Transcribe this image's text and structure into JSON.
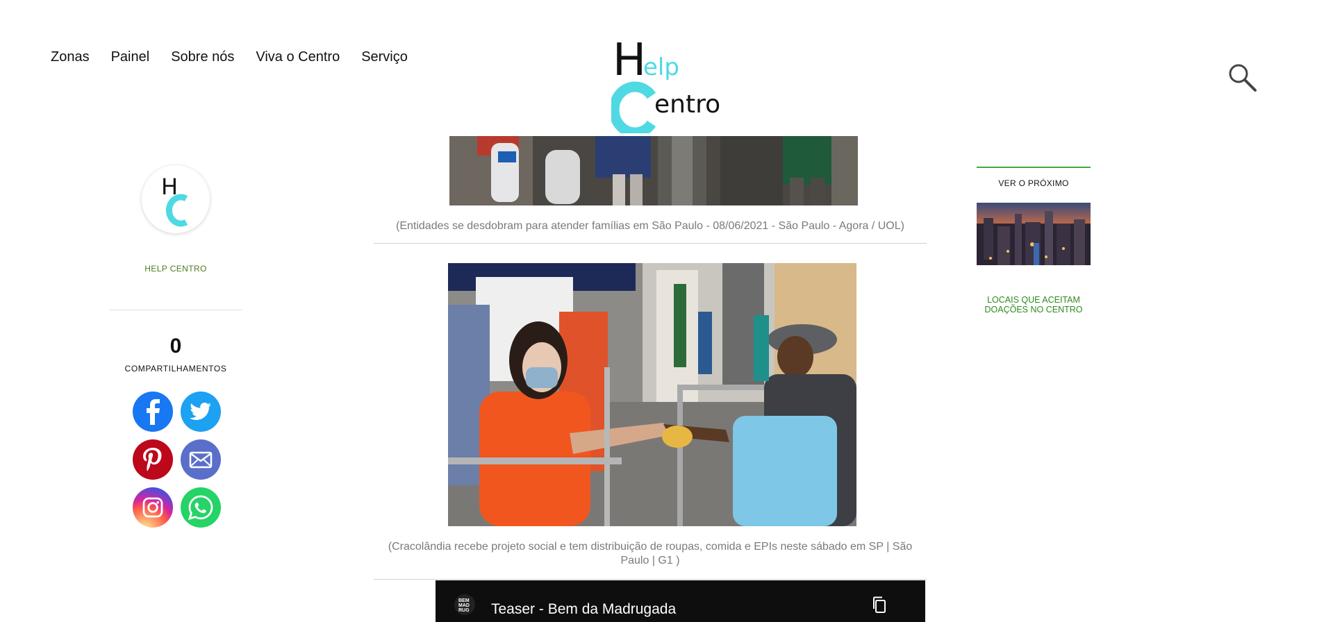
{
  "nav": {
    "items": [
      {
        "label": "Zonas"
      },
      {
        "label": "Painel"
      },
      {
        "label": "Sobre nós"
      },
      {
        "label": "Viva o Centro"
      },
      {
        "label": "Serviço"
      }
    ]
  },
  "logo": {
    "line1": "Help",
    "line2": "Centro",
    "primary_color": "#111111",
    "accent_color": "#4fd9e3"
  },
  "search": {
    "icon": "search-icon"
  },
  "author": {
    "avatar_letters": "HC",
    "name": "HELP CENTRO"
  },
  "share": {
    "count": "0",
    "label": "COMPARTILHAMENTOS",
    "buttons": [
      {
        "network": "facebook",
        "icon": "facebook-icon",
        "color": "#1877f2"
      },
      {
        "network": "twitter",
        "icon": "twitter-icon",
        "color": "#1da1f2"
      },
      {
        "network": "pinterest",
        "icon": "pinterest-icon",
        "color": "#bd081c"
      },
      {
        "network": "email",
        "icon": "mail-icon",
        "color": "#5a6fc9"
      },
      {
        "network": "instagram",
        "icon": "instagram-icon",
        "color": "#d6249f"
      },
      {
        "network": "whatsapp",
        "icon": "whatsapp-icon",
        "color": "#25d366"
      }
    ]
  },
  "article": {
    "caption1": "(Entidades se desdobram para atender famílias em São Paulo - 08/06/2021 - São Paulo - Agora / UOL)",
    "caption2": "(Cracolândia recebe projeto social e tem distribuição de roupas, comida e EPIs neste sábado em SP | São Paulo | G1 )",
    "video": {
      "title": "Teaser - Bem da Madrugada",
      "channel_badge": "BEM MAD RUG"
    }
  },
  "sidebar_right": {
    "next_label": "VER O PRÓXIMO",
    "link": "LOCAIS QUE ACEITAM DOAÇÕES NO CENTRO"
  }
}
